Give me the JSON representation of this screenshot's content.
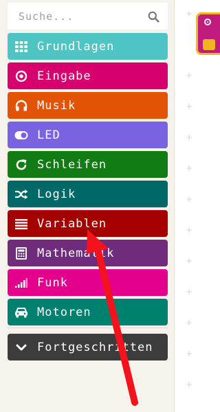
{
  "search": {
    "placeholder": "Suche..."
  },
  "categories": [
    {
      "label": "Grundlagen",
      "icon": "grid-icon",
      "color": "#4fc4c4"
    },
    {
      "label": "Eingabe",
      "icon": "target-icon",
      "color": "#d6006f"
    },
    {
      "label": "Musik",
      "icon": "headphones-icon",
      "color": "#e25305"
    },
    {
      "label": "LED",
      "icon": "toggle-icon",
      "color": "#7a63e0"
    },
    {
      "label": "Schleifen",
      "icon": "refresh-icon",
      "color": "#117c13"
    },
    {
      "label": "Logik",
      "icon": "shuffle-icon",
      "color": "#006866"
    },
    {
      "label": "Variablen",
      "icon": "list-icon",
      "color": "#a40000"
    },
    {
      "label": "Mathematik",
      "icon": "calculator-icon",
      "color": "#702c7c"
    },
    {
      "label": "Funk",
      "icon": "signal-bars-icon",
      "color": "#e3008c"
    },
    {
      "label": "Motoren",
      "icon": "car-icon",
      "color": "#00806f"
    }
  ],
  "advanced": {
    "label": "Fortgeschritten",
    "icon": "chevron-down-icon",
    "color": "#3c3c3c"
  },
  "colors": {
    "toolbox_bg": "#f5f3ec",
    "arrow": "#f4121d",
    "block_border": "#f3b51e"
  }
}
